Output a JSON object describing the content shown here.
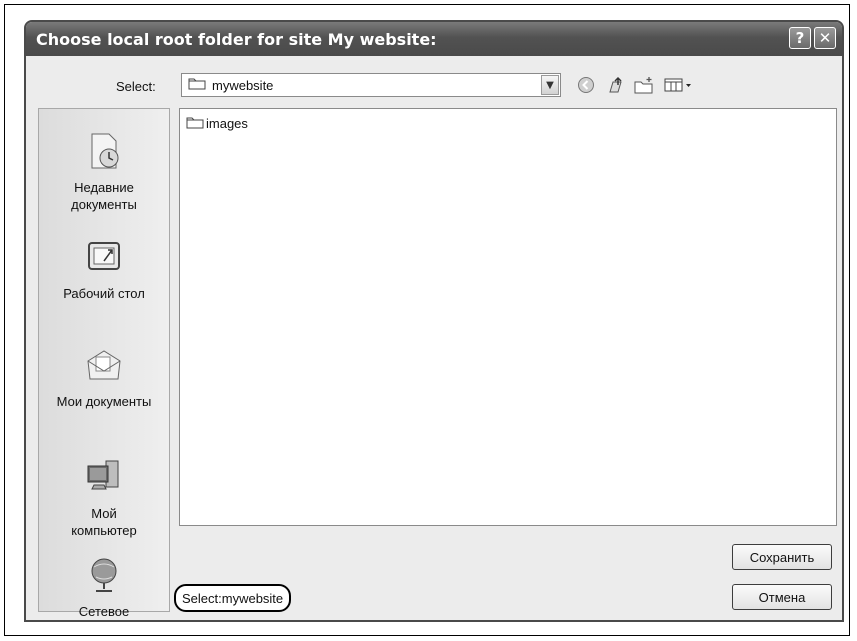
{
  "dialog": {
    "title": "Choose local root folder for site My website:",
    "help_label": "?",
    "close_label": "✕"
  },
  "toolbar": {
    "select_label": "Select:",
    "combo_value": "mywebsite",
    "combo_arrow": "▼"
  },
  "places": [
    {
      "label": "Недавние\nдокументы",
      "icon": "recent-documents-icon"
    },
    {
      "label": "Рабочий стол",
      "icon": "desktop-icon"
    },
    {
      "label": "Мои документы",
      "icon": "my-documents-icon"
    },
    {
      "label": "Мой\nкомпьютер",
      "icon": "my-computer-icon"
    },
    {
      "label": "Сетевое",
      "icon": "network-icon"
    }
  ],
  "files": [
    {
      "name": "images",
      "icon": "folder-icon"
    }
  ],
  "buttons": {
    "save": "Сохранить",
    "cancel": "Отмена"
  },
  "status": {
    "text": "Select:mywebsite"
  }
}
